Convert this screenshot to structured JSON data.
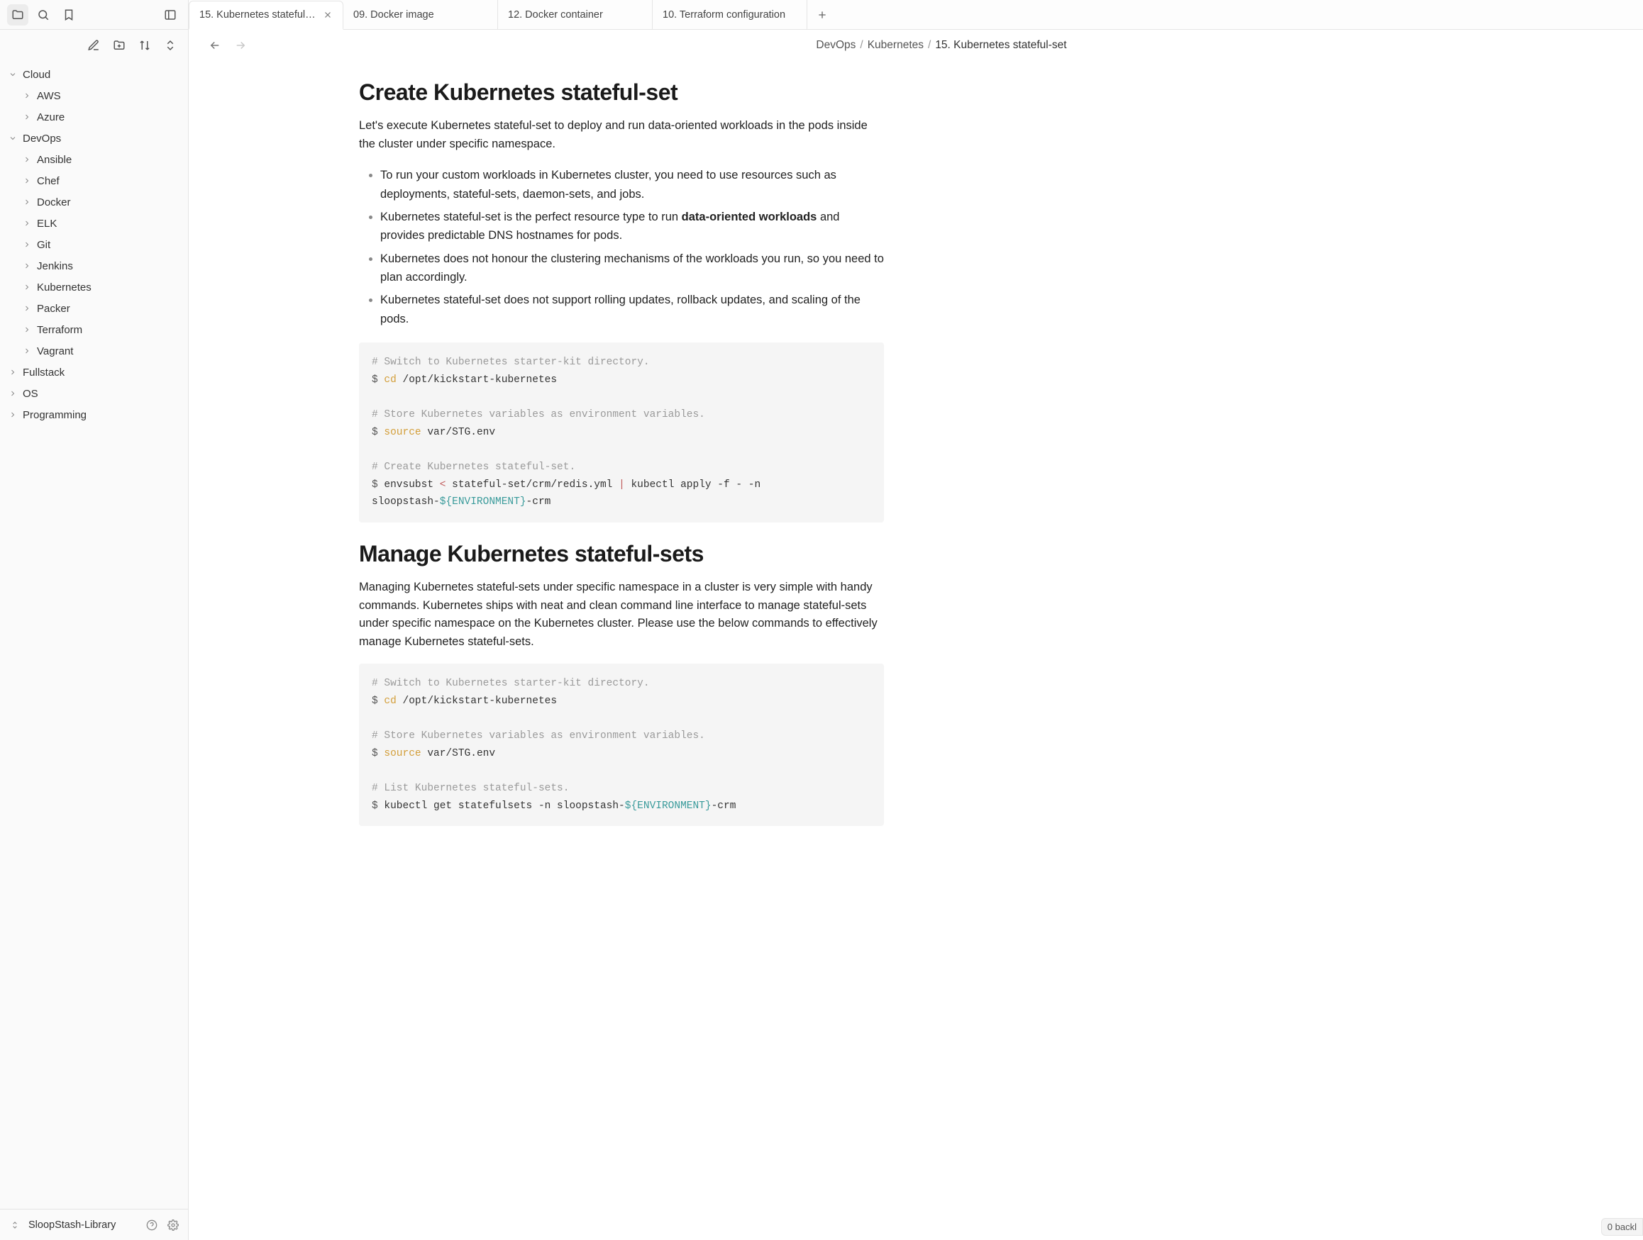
{
  "sidebar": {
    "library_name": "SloopStash-Library",
    "tree": [
      {
        "label": "Cloud",
        "depth": 0,
        "expanded": true
      },
      {
        "label": "AWS",
        "depth": 1,
        "expanded": false
      },
      {
        "label": "Azure",
        "depth": 1,
        "expanded": false
      },
      {
        "label": "DevOps",
        "depth": 0,
        "expanded": true
      },
      {
        "label": "Ansible",
        "depth": 1,
        "expanded": false
      },
      {
        "label": "Chef",
        "depth": 1,
        "expanded": false
      },
      {
        "label": "Docker",
        "depth": 1,
        "expanded": false
      },
      {
        "label": "ELK",
        "depth": 1,
        "expanded": false
      },
      {
        "label": "Git",
        "depth": 1,
        "expanded": false
      },
      {
        "label": "Jenkins",
        "depth": 1,
        "expanded": false
      },
      {
        "label": "Kubernetes",
        "depth": 1,
        "expanded": false
      },
      {
        "label": "Packer",
        "depth": 1,
        "expanded": false
      },
      {
        "label": "Terraform",
        "depth": 1,
        "expanded": false
      },
      {
        "label": "Vagrant",
        "depth": 1,
        "expanded": false
      },
      {
        "label": "Fullstack",
        "depth": 0,
        "expanded": false
      },
      {
        "label": "OS",
        "depth": 0,
        "expanded": false
      },
      {
        "label": "Programming",
        "depth": 0,
        "expanded": false
      }
    ]
  },
  "tabs": [
    {
      "label": "15. Kubernetes stateful-s...",
      "active": true,
      "closeable": true
    },
    {
      "label": "09. Docker image",
      "active": false,
      "closeable": false
    },
    {
      "label": "12. Docker container",
      "active": false,
      "closeable": false
    },
    {
      "label": "10. Terraform configuration",
      "active": false,
      "closeable": false
    }
  ],
  "breadcrumbs": [
    "DevOps",
    "Kubernetes",
    "15. Kubernetes stateful-set"
  ],
  "document": {
    "h1_a": "Create Kubernetes stateful-set",
    "p1": "Let's execute Kubernetes stateful-set to deploy and run data-oriented workloads in the pods inside the cluster under specific namespace.",
    "bullets_a": [
      {
        "pre": "To run your custom workloads in Kubernetes cluster, you need to use resources such as deployments, stateful-sets, daemon-sets, and jobs.",
        "bold": "",
        "post": ""
      },
      {
        "pre": "Kubernetes stateful-set is the perfect resource type to run ",
        "bold": "data-oriented workloads",
        "post": " and provides predictable DNS hostnames for pods."
      },
      {
        "pre": "Kubernetes does not honour the clustering mechanisms of the workloads you run, so you need to plan accordingly.",
        "bold": "",
        "post": ""
      },
      {
        "pre": "Kubernetes stateful-set does not support rolling updates, rollback updates, and scaling of the pods.",
        "bold": "",
        "post": ""
      }
    ],
    "code_a": {
      "c1": "# Switch to Kubernetes starter-kit directory.",
      "l1_prompt": "$ ",
      "l1_kw": "cd",
      "l1_rest": " /opt/kickstart-kubernetes",
      "c2": "# Store Kubernetes variables as environment variables.",
      "l2_prompt": "$ ",
      "l2_kw": "source",
      "l2_rest": " var/STG.env",
      "c3": "# Create Kubernetes stateful-set.",
      "l3_prompt": "$ ",
      "l3_a": "envsubst ",
      "l3_op1": "<",
      "l3_b": " stateful-set/crm/redis.yml ",
      "l3_op2": "|",
      "l3_c": " kubectl apply -f - -n sloopstash-",
      "l3_var": "${ENVIRONMENT}",
      "l3_d": "-crm"
    },
    "h1_b": "Manage Kubernetes stateful-sets",
    "p2": "Managing Kubernetes stateful-sets under specific namespace in a cluster is very simple with handy commands. Kubernetes ships with neat and clean command line interface to manage stateful-sets under specific namespace on the Kubernetes cluster. Please use the below commands to effectively manage Kubernetes stateful-sets.",
    "code_b": {
      "c1": "# Switch to Kubernetes starter-kit directory.",
      "l1_prompt": "$ ",
      "l1_kw": "cd",
      "l1_rest": " /opt/kickstart-kubernetes",
      "c2": "# Store Kubernetes variables as environment variables.",
      "l2_prompt": "$ ",
      "l2_kw": "source",
      "l2_rest": " var/STG.env",
      "c3": "# List Kubernetes stateful-sets.",
      "l3_prompt": "$ ",
      "l3_a": "kubectl get statefulsets -n sloopstash-",
      "l3_var": "${ENVIRONMENT}",
      "l3_b": "-crm"
    }
  },
  "footer": {
    "backlinks": "0 backl"
  }
}
